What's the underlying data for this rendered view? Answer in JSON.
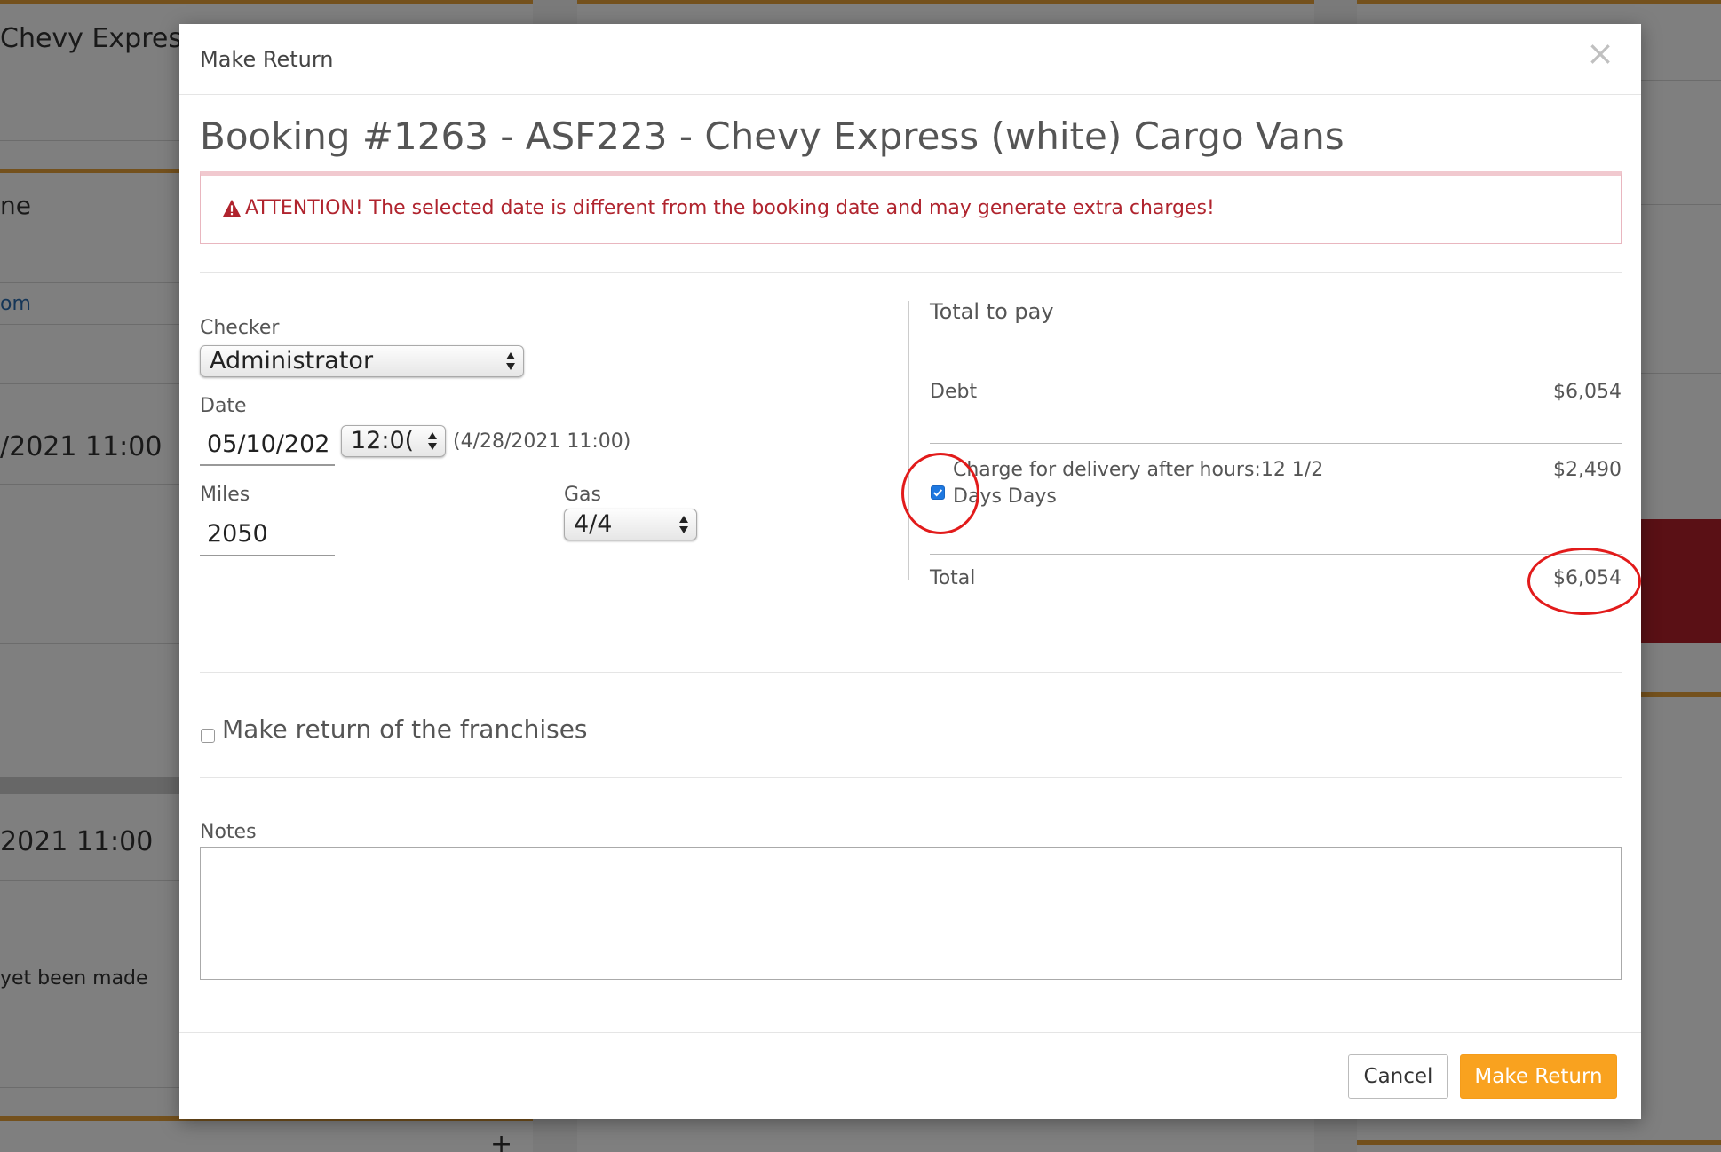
{
  "background": {
    "vehicle_fragment": "Chevy Express",
    "name_fragment": "ne",
    "email_fragment": "om",
    "date_fragment_1": "/2021 11:00",
    "date_fragment_2": "2021 11:00",
    "status_fragment": "yet been made",
    "plus_label": "+"
  },
  "modal": {
    "title": "Make Return",
    "close_label": "×",
    "booking_title": "Booking #1263 - ASF223 - Chevy Express (white) Cargo Vans",
    "alert_text": "ATTENTION! The selected date is different from the booking date and may generate extra charges!",
    "form": {
      "checker_label": "Checker",
      "checker_value": "Administrator",
      "date_label": "Date",
      "date_value": "05/10/202",
      "time_value": "12:0(",
      "original_date": "(4/28/2021 11:00)",
      "miles_label": "Miles",
      "miles_value": "2050",
      "gas_label": "Gas",
      "gas_value": "4/4"
    },
    "summary": {
      "total_to_pay_label": "Total to pay",
      "debt_label": "Debt",
      "debt_value": "$6,054",
      "charge_label": "Charge for delivery after hours:12 1/2 Days Days",
      "charge_value": "$2,490",
      "charge_checked": true,
      "total_label": "Total",
      "total_value": "$6,054"
    },
    "franchise_label": "Make return of the franchises",
    "notes_label": "Notes",
    "notes_value": "",
    "cancel_label": "Cancel",
    "submit_label": "Make Return"
  },
  "colors": {
    "accent": "#f9a21f",
    "alert_text": "#b0242e",
    "annotation": "#e21b1b",
    "checkbox": "#1e78e0"
  }
}
